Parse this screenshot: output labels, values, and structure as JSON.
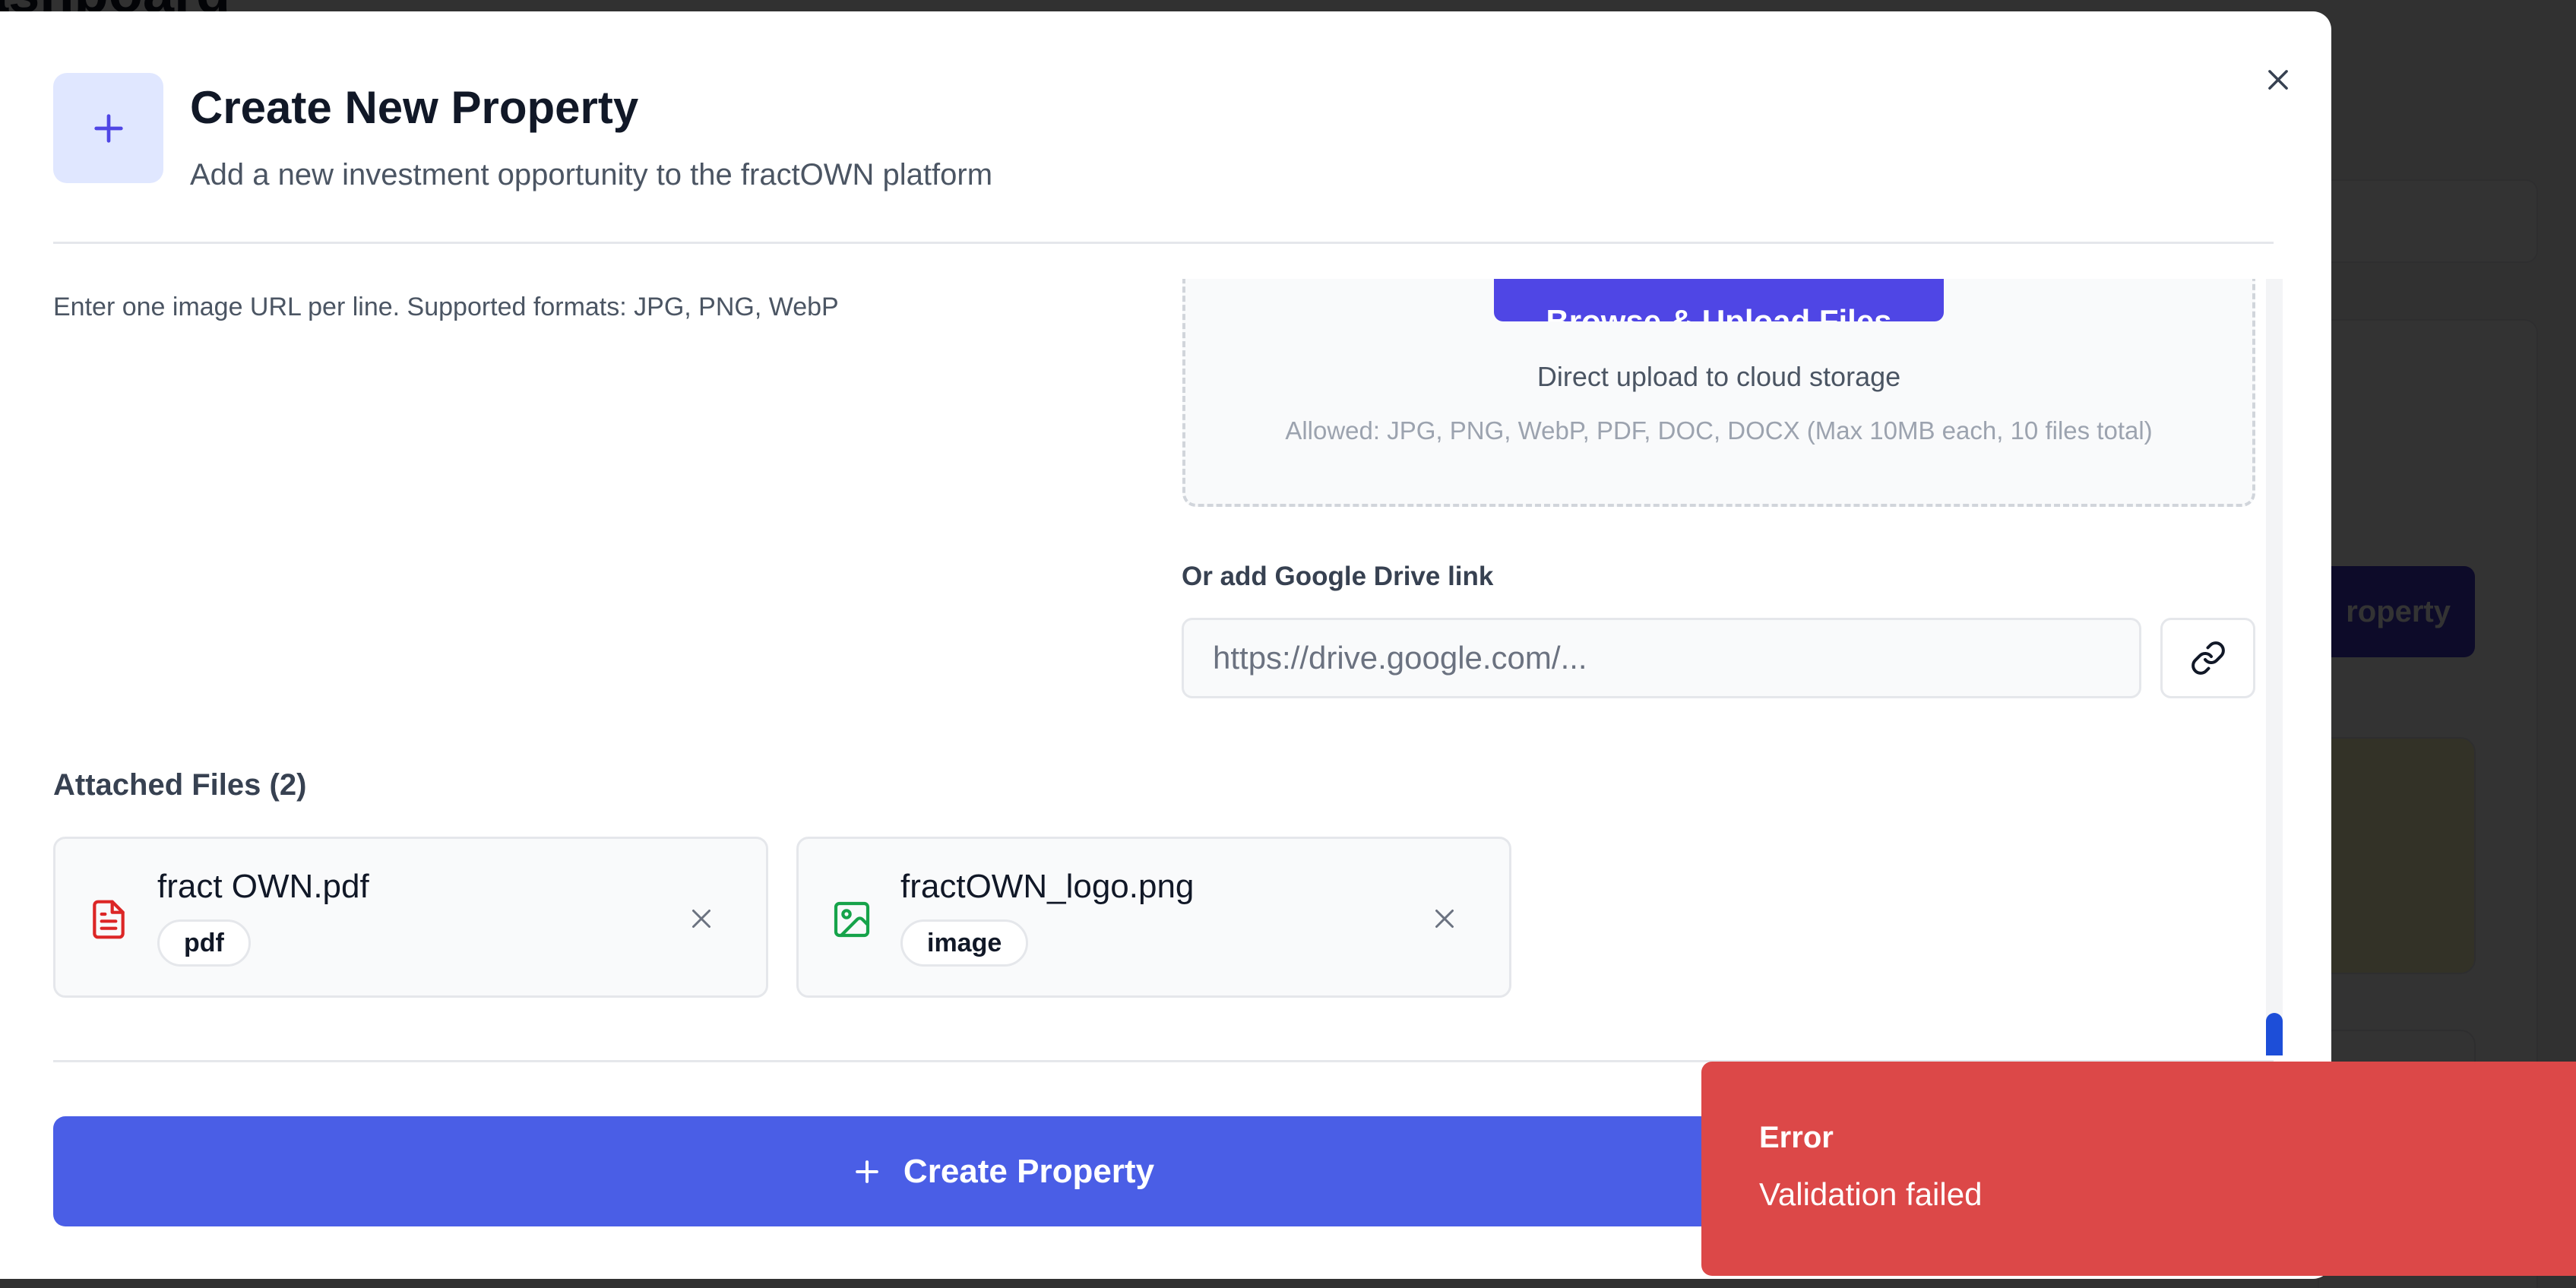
{
  "background": {
    "title_fragment": "ashboard",
    "button_fragment": "roperty"
  },
  "modal": {
    "title": "Create New Property",
    "subtitle": "Add a new investment opportunity to the fractOWN platform",
    "image_url_hint": "Enter one image URL per line. Supported formats: JPG, PNG, WebP",
    "upload": {
      "button_label": "Browse & Upload Files",
      "main_text": "Direct upload to cloud storage",
      "allowed_text": "Allowed: JPG, PNG, WebP, PDF, DOC, DOCX (Max 10MB each, 10 files total)"
    },
    "google_drive": {
      "label": "Or add Google Drive link",
      "placeholder": "https://drive.google.com/...",
      "value": ""
    },
    "attached": {
      "label": "Attached Files (2)",
      "files": [
        {
          "name": "fract OWN.pdf",
          "type": "pdf",
          "icon": "file-text-icon"
        },
        {
          "name": "fractOWN_logo.png",
          "type": "image",
          "icon": "image-icon"
        }
      ]
    },
    "submit_label": "Create Property"
  },
  "toast": {
    "title": "Error",
    "message": "Validation failed"
  },
  "colors": {
    "primary": "#4a5ee6",
    "error": "#dc4848",
    "pdf_icon": "#dc2626",
    "image_icon": "#16a34a",
    "header_icon_bg": "#e0e7ff"
  }
}
